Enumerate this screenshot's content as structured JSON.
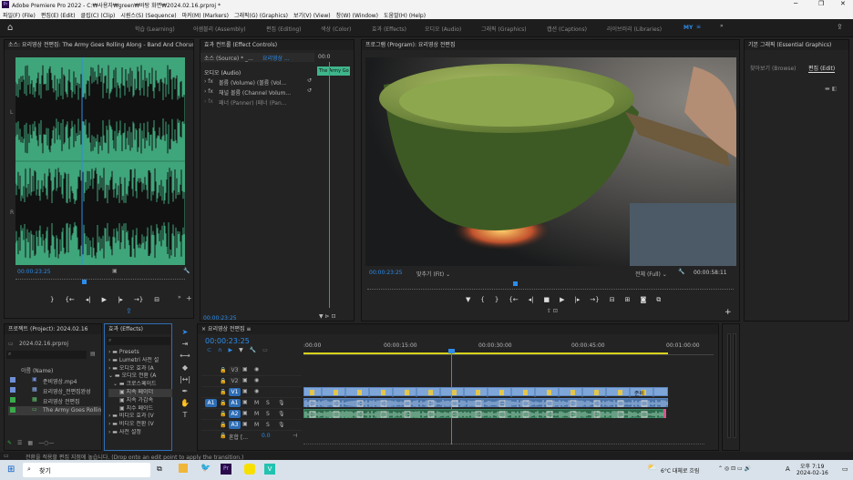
{
  "titlebar": {
    "title": "Adobe Premiere Pro 2022 - C:₩사용자₩green₩바탕 화면₩2024.02.16.prproj *"
  },
  "menu": [
    "파일(F) (File)",
    "편집(E) (Edit)",
    "클립(C) (Clip)",
    "시퀀스(S) (Sequence)",
    "마커(M) (Markers)",
    "그래픽(G) (Graphics)",
    "보기(V) (View)",
    "창(W) (Window)",
    "도움말(H) (Help)"
  ],
  "workspaces": [
    "학습 (Learning)",
    "어셈블리 (Assembly)",
    "편집 (Editing)",
    "색상 (Color)",
    "효과 (Effects)",
    "오디오 (Audio)",
    "그래픽 (Graphics)",
    "캡션 (Captions)",
    "라이브러리 (Libraries)",
    "MY"
  ],
  "source": {
    "title": "소스: 요리영상 전편집: The Army Goes Rolling Along - Band And Chorus",
    "timecode": "00:00:23:25"
  },
  "effect_controls": {
    "title": "효과 컨트롤 (Effect Controls)",
    "source_label": "소스 (Source) * _...",
    "seq_label": "요리영상 ...",
    "time_start": "00:0",
    "clip_label": "The Army Go",
    "section": "오디오 (Audio)",
    "rows": [
      "볼륨 (Volume) (볼륨 (Vol...",
      "채널 볼륨 (Channel Volum...",
      "패너 (Panner) (패너 (Pan..."
    ],
    "timecode": "00:00:23:25"
  },
  "program": {
    "title": "프로그램 (Program): 요리영상 전편집",
    "timecode": "00:00:23:25",
    "fit": "맞추기 (Fit)",
    "quality": "전체 (Full)",
    "duration": "00:00:58:11"
  },
  "essential": {
    "title": "기본 그래픽 (Essential Graphics)",
    "tabs": [
      "찾아보기 (Browse)",
      "편집 (Edit)"
    ]
  },
  "project": {
    "title": "프로젝트 (Project): 2024.02.16",
    "file": "2024.02.16.prproj",
    "header": "이름 (Name)",
    "items": [
      {
        "name": "준비영상.mp4",
        "color": "#6f8fd6"
      },
      {
        "name": "요리영상_전편집완성",
        "color": "#6f8fd6"
      },
      {
        "name": "요리영상 전편집",
        "color": "#3aaa4b"
      },
      {
        "name": "The Army Goes Rolling",
        "color": "#3aaa4b"
      }
    ]
  },
  "effects": {
    "title": "효과 (Effects)",
    "items": [
      "Presets",
      "Lumetri 사전 설",
      "오디오 효과 (A",
      "오디오 전환 (A",
      "크로스페이드",
      "지속 페이더",
      "지속 가감속",
      "지수 페이드",
      "비디오 효과 (V",
      "비디오 전환 (V",
      "사전 설정"
    ]
  },
  "timeline": {
    "title": "요리영상 전편집",
    "timecode": "00:00:23:25",
    "ruler": [
      ":00:00",
      "00:00:15:00",
      "00:00:30:00",
      "00:00:45:00",
      "00:01:00:00"
    ],
    "video_tracks": [
      "V3",
      "V2",
      "V1"
    ],
    "audio_tracks": [
      "A1",
      "A2",
      "A3"
    ],
    "mix": "혼합",
    "mix_value": "0.0",
    "clip_label": "준비"
  },
  "status": {
    "text": "전환을 적용할 편집 지점에 놓습니다. (Drop onto an edit point to apply the transition.)"
  },
  "taskbar": {
    "search": "찾기",
    "weather": "6°C 대체로 흐림",
    "time": "오후 7:19",
    "date": "2024-02-16",
    "ime": "A"
  }
}
